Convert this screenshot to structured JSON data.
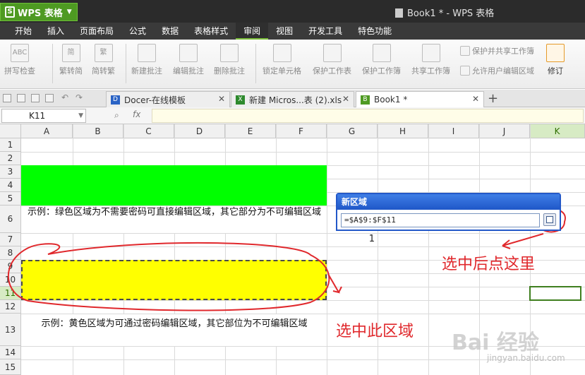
{
  "app": {
    "menu_label": "WPS 表格",
    "window_title": "Book1 * - WPS 表格"
  },
  "menubar": [
    "开始",
    "插入",
    "页面布局",
    "公式",
    "数据",
    "表格样式",
    "审阅",
    "视图",
    "开发工具",
    "特色功能"
  ],
  "ribbon": {
    "spell": "拼写检查",
    "to_trad": "繁转简",
    "to_simp": "简转繁",
    "new_comment": "新建批注",
    "edit_comment": "编辑批注",
    "del_comment": "删除批注",
    "lock_cell": "锁定单元格",
    "protect_sheet": "保护工作表",
    "protect_book": "保护工作簿",
    "share_book": "共享工作簿",
    "protect_share": "保护并共享工作簿",
    "allow_edit": "允许用户编辑区域",
    "revise": "修订",
    "icon_abc": "ABC",
    "icon_jian": "简",
    "icon_fan": "繁"
  },
  "tabs": [
    {
      "label": "Docer-在线模板",
      "icon": "D"
    },
    {
      "label": "新建 Micros...表 (2).xls",
      "icon": "X"
    },
    {
      "label": "Book1 *",
      "icon": "B"
    }
  ],
  "formula": {
    "cell_ref": "K11",
    "fx": "fx"
  },
  "columns": [
    "A",
    "B",
    "C",
    "D",
    "E",
    "F",
    "G",
    "H",
    "I",
    "J",
    "K"
  ],
  "rows": [
    "1",
    "2",
    "3",
    "4",
    "5",
    "6",
    "7",
    "8",
    "9",
    "10",
    "11",
    "12",
    "13",
    "14",
    "15"
  ],
  "cells": {
    "G7": "1"
  },
  "notes": {
    "green": "示例：绿色区域为不需要密码可直接编辑区域，其它部分为不可编辑区域",
    "yellow": "示例：黄色区域为可通过密码编辑区域，其它部位为不可编辑区域"
  },
  "dialog": {
    "title": "新区域",
    "value": "=$A$9:$F$11"
  },
  "annotations": {
    "click_here": "选中后点这里",
    "select_area": "选中此区域"
  },
  "watermark": {
    "logo": "Bai 经验",
    "url": "jingyan.baidu.com"
  },
  "colors": {
    "green_fill": "#00ff00",
    "yellow_fill": "#ffff00",
    "annotation": "#e0282c",
    "accent": "#4e9a22"
  }
}
